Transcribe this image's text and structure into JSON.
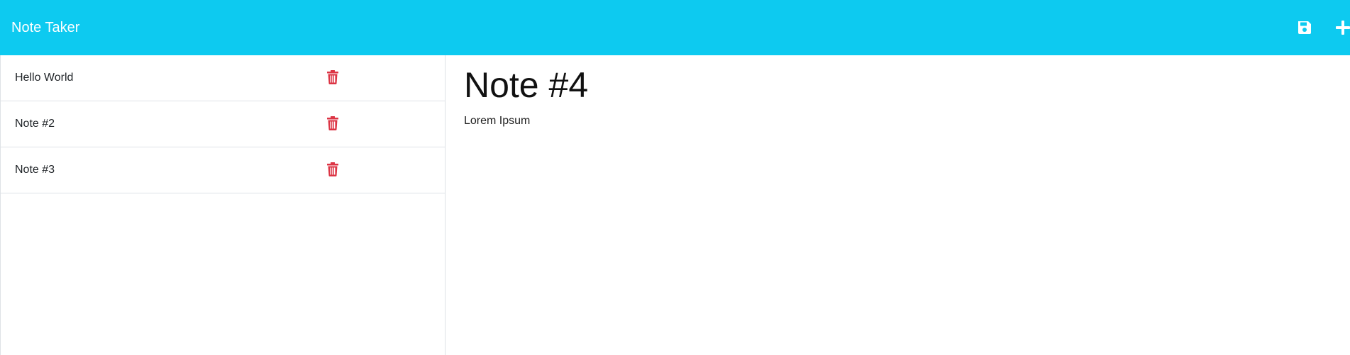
{
  "navbar": {
    "brand": "Note Taker",
    "background": "#0dcaf0",
    "save_icon": "floppy-disk-icon",
    "new_icon": "plus-icon"
  },
  "sidebar": {
    "notes": [
      {
        "title": "Hello World"
      },
      {
        "title": "Note #2"
      },
      {
        "title": "Note #3"
      }
    ],
    "delete_icon": "trash-icon",
    "delete_color": "#dc3545"
  },
  "editor": {
    "title": "Note #4",
    "body": "Lorem Ipsum"
  }
}
